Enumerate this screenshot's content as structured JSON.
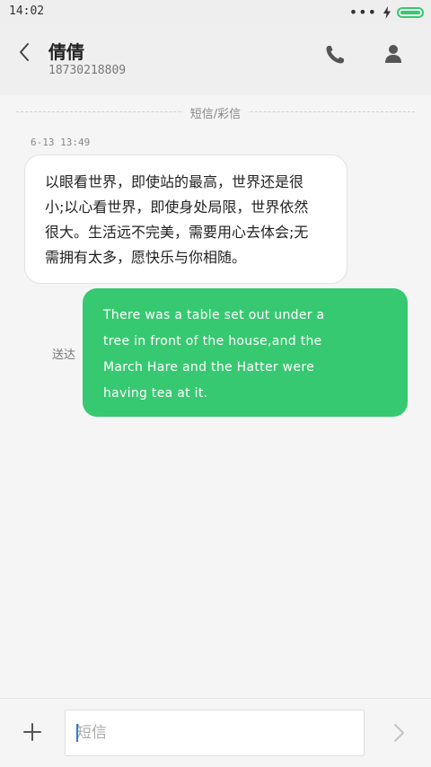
{
  "status_bar": {
    "time": "14:02",
    "icons": [
      "more-dots-icon",
      "charging-bolt-icon",
      "battery-icon"
    ],
    "battery_color": "#37c971"
  },
  "header": {
    "contact_name": "倩倩",
    "contact_number": "18730218809",
    "icons": [
      "back-arrow-icon",
      "phone-icon",
      "person-icon"
    ]
  },
  "thread": {
    "divider_label": "短信/彩信",
    "timestamp": "6-13 13:49",
    "incoming_message": {
      "lines": [
        "以眼看世界，即使站的最高，世界还是很",
        "小;以心看世界，即使身处局限，世界依然",
        "很大。生活远不完美，需要用心去体会;无",
        "需拥有太多，愿快乐与你相随。"
      ]
    },
    "outgoing_message": {
      "status": "送达",
      "lines": [
        "There was a table set out under a",
        "tree in front of the house,and the",
        "March Hare and the Hatter were",
        "having tea at it."
      ],
      "bubble_color": "#37c971"
    }
  },
  "composer": {
    "placeholder": "短信",
    "value": "",
    "icons": [
      "plus-icon",
      "send-chevron-icon"
    ]
  }
}
